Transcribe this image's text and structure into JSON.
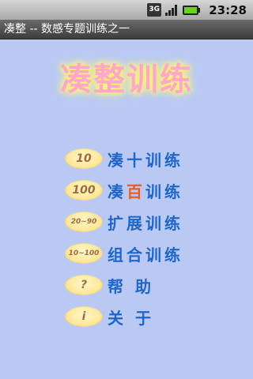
{
  "status_bar": {
    "network": "3G",
    "time": "23:28",
    "icons": [
      "3g-icon",
      "signal-icon",
      "battery-icon"
    ]
  },
  "app": {
    "title": "凑整 -- 数感专题训练之一"
  },
  "main": {
    "headline": "凑整训练",
    "menu": [
      {
        "badge": "10",
        "label": "凑十训练"
      },
      {
        "badge": "100",
        "label_pre": "凑",
        "label_highlight": "百",
        "label_post": "训练"
      },
      {
        "badge": "20~90",
        "label": "扩展训练"
      },
      {
        "badge": "10~100",
        "label": "组合训练"
      },
      {
        "badge": "?",
        "label": "帮 助"
      },
      {
        "badge": "i",
        "label": "关 于"
      }
    ]
  },
  "colors": {
    "background": "#b9c9f3",
    "headline": "#ffa8c9",
    "headline_glow": "#fff36a",
    "menu_label": "#1f66c7",
    "menu_highlight": "#f05a1a",
    "badge_fill": "#ffe9a0",
    "badge_text": "#a36b3b"
  }
}
